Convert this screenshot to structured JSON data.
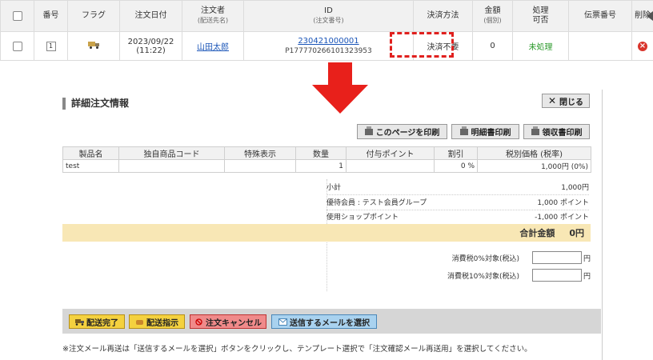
{
  "order_table": {
    "headers": {
      "number": "番号",
      "flag": "フラグ",
      "order_date": "注文日付",
      "orderer": "注文者",
      "orderer_sub": "(配送先名)",
      "id": "ID",
      "id_sub": "(注文番号)",
      "payment": "決済方法",
      "amount": "金額",
      "amount_sub": "(個別)",
      "process": "処理",
      "process2": "可否",
      "slip": "伝票番号",
      "delete": "削除"
    },
    "row": {
      "number": "1",
      "date": "2023/09/22",
      "time": "(11:22)",
      "orderer": "山田太郎",
      "id": "230421000001",
      "order_no": "P177770266101323953",
      "payment": "決済不要",
      "amount": "0",
      "status": "未処理",
      "slip": ""
    }
  },
  "detail": {
    "title": "詳細注文情報",
    "close_label": "閉じる",
    "print_buttons": [
      "このページを印刷",
      "明細書印刷",
      "領収書印刷"
    ],
    "columns": [
      "製品名",
      "独自商品コード",
      "特殊表示",
      "数量",
      "付与ポイント",
      "割引",
      "税別価格 (税率)"
    ],
    "item": {
      "name": "test",
      "code": "",
      "special": "",
      "qty": "1",
      "points": "",
      "discount": "0 %",
      "price": "1,000円 (0%)"
    },
    "summary": [
      {
        "label": "小計",
        "value": "1,000円"
      },
      {
        "label": "優待会員 : テスト会員グループ",
        "value": "1,000 ポイント"
      },
      {
        "label": "使用ショップポイント",
        "value": "-1,000 ポイント"
      }
    ],
    "total_label": "合計金額",
    "total_value": "0円",
    "tax_rows": [
      {
        "label": "消費税0%対象(税込)",
        "unit": "円"
      },
      {
        "label": "消費税10%対象(税込)",
        "unit": "円"
      }
    ]
  },
  "actions": [
    "配送完了",
    "配送指示",
    "注文キャンセル",
    "送信するメールを選択"
  ],
  "note": "※注文メール再送は「送信するメールを選択」ボタンをクリックし、テンプレート選択で「注文確認メール再送用」を選択してください。",
  "colors": {
    "highlight": "#e0201e",
    "total_bg": "#f8e7b5",
    "link": "#1a55b8"
  }
}
